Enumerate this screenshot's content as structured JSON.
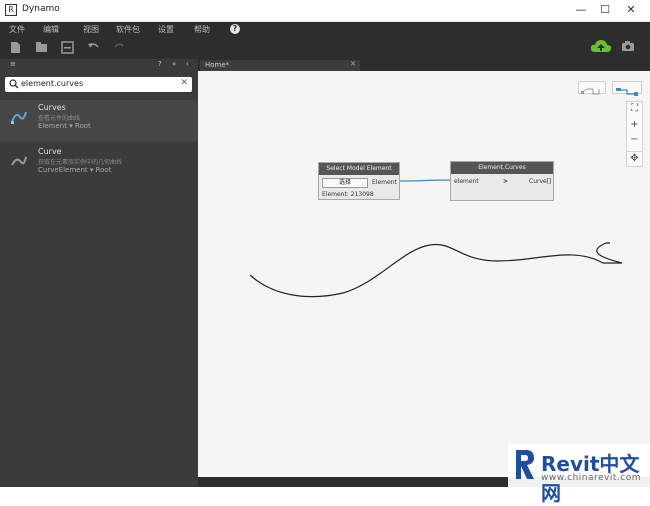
{
  "window": {
    "title": "Dynamo",
    "minimize": "—",
    "maximize": "☐",
    "close": "✕"
  },
  "menu": {
    "items": [
      "文件",
      "编辑",
      "视图",
      "软件包",
      "设置",
      "帮助"
    ],
    "help_badge": "?"
  },
  "panel_strip": {
    "left_symbol": "≡",
    "controls": [
      "?",
      "«",
      "‹"
    ]
  },
  "tab": {
    "label": "Home*",
    "close": "✕"
  },
  "library": {
    "search": {
      "value": "element.curves",
      "clear": "✕"
    },
    "results": [
      {
        "title": "Curves",
        "description": "查看元件的曲线",
        "params": "Element ▾ Root"
      },
      {
        "title": "Curve",
        "description": "获取在元素族实例中的几何曲线",
        "params": "CurveElement ▾ Root"
      }
    ]
  },
  "canvas": {
    "zoom_fit": "⛶",
    "zoom_in": "+",
    "zoom_out": "−",
    "pan": "✥"
  },
  "nodes": {
    "select_model": {
      "title": "Select Model Element",
      "button": "选择",
      "output": "Element",
      "footer": "Element: 213098"
    },
    "element_curves": {
      "title": "Element.Curves",
      "input": "element",
      "input_marker": ">",
      "output": "Curve[]"
    }
  },
  "watermark": {
    "brand": "Revit中文网",
    "url": "www.chinarevit.com"
  },
  "colors": {
    "toolbar": "#2d2d2d",
    "library": "#3b3b3b",
    "cloud": "#6ac12f",
    "wire": "#3a8fb7",
    "brand": "#1f4e9c"
  }
}
